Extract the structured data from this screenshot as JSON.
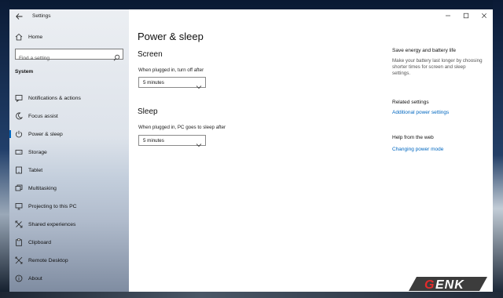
{
  "app": {
    "title": "Settings"
  },
  "sidebar": {
    "home_label": "Home",
    "search_placeholder": "Find a setting",
    "section": "System",
    "items": [
      {
        "label": "Notifications & actions",
        "icon": "notifications-icon"
      },
      {
        "label": "Focus assist",
        "icon": "moon-icon"
      },
      {
        "label": "Power & sleep",
        "icon": "power-icon",
        "selected": true
      },
      {
        "label": "Storage",
        "icon": "storage-icon"
      },
      {
        "label": "Tablet",
        "icon": "tablet-icon"
      },
      {
        "label": "Multitasking",
        "icon": "multitasking-icon"
      },
      {
        "label": "Projecting to this PC",
        "icon": "projecting-icon"
      },
      {
        "label": "Shared experiences",
        "icon": "shared-experiences-icon"
      },
      {
        "label": "Clipboard",
        "icon": "clipboard-icon"
      },
      {
        "label": "Remote Desktop",
        "icon": "remote-desktop-icon"
      },
      {
        "label": "About",
        "icon": "info-icon"
      }
    ]
  },
  "main": {
    "title": "Power & sleep",
    "screen": {
      "heading": "Screen",
      "label": "When plugged in, turn off after",
      "value": "5 minutes"
    },
    "sleep": {
      "heading": "Sleep",
      "label": "When plugged in, PC goes to sleep after",
      "value": "5 minutes"
    }
  },
  "right_panel": {
    "tip_heading": "Save energy and battery life",
    "tip_text": "Make your battery last longer by choosing shorter times for screen and sleep settings.",
    "related_heading": "Related settings",
    "related_link": "Additional power settings",
    "help_heading": "Help from the web",
    "help_link": "Changing power mode"
  },
  "watermark": {
    "text": "GENK"
  },
  "colors": {
    "accent": "#0067c0",
    "selection_bar": "#0067c0"
  }
}
